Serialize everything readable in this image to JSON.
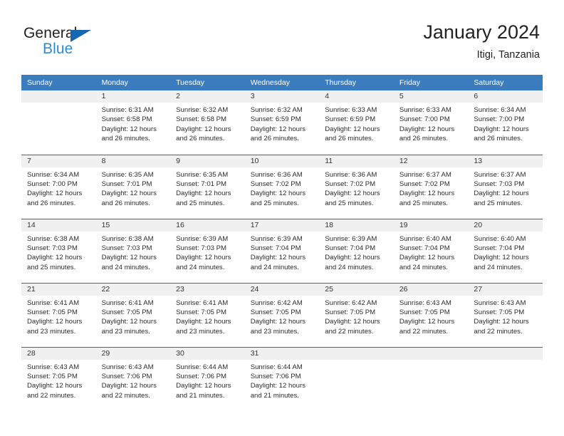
{
  "brand": {
    "name_part1": "General",
    "name_part2": "Blue",
    "triangle_icon": "triangle-icon",
    "colors": {
      "dark": "#231f20",
      "blue": "#2e8bd0",
      "triangle": "#1667b1"
    }
  },
  "header": {
    "title": "January 2024",
    "subtitle": "Itigi, Tanzania"
  },
  "theme": {
    "header_bg": "#3a7cbe",
    "header_text": "#ffffff",
    "daynum_band_bg": "#f0f0f0",
    "row_divider": "#2a6dad",
    "body_text": "#2b2b2b"
  },
  "calendar": {
    "weekday_headers": [
      "Sunday",
      "Monday",
      "Tuesday",
      "Wednesday",
      "Thursday",
      "Friday",
      "Saturday"
    ],
    "weeks": [
      [
        {
          "day": "",
          "lines": []
        },
        {
          "day": "1",
          "lines": [
            "Sunrise: 6:31 AM",
            "Sunset: 6:58 PM",
            "Daylight: 12 hours",
            "and 26 minutes."
          ]
        },
        {
          "day": "2",
          "lines": [
            "Sunrise: 6:32 AM",
            "Sunset: 6:58 PM",
            "Daylight: 12 hours",
            "and 26 minutes."
          ]
        },
        {
          "day": "3",
          "lines": [
            "Sunrise: 6:32 AM",
            "Sunset: 6:59 PM",
            "Daylight: 12 hours",
            "and 26 minutes."
          ]
        },
        {
          "day": "4",
          "lines": [
            "Sunrise: 6:33 AM",
            "Sunset: 6:59 PM",
            "Daylight: 12 hours",
            "and 26 minutes."
          ]
        },
        {
          "day": "5",
          "lines": [
            "Sunrise: 6:33 AM",
            "Sunset: 7:00 PM",
            "Daylight: 12 hours",
            "and 26 minutes."
          ]
        },
        {
          "day": "6",
          "lines": [
            "Sunrise: 6:34 AM",
            "Sunset: 7:00 PM",
            "Daylight: 12 hours",
            "and 26 minutes."
          ]
        }
      ],
      [
        {
          "day": "7",
          "lines": [
            "Sunrise: 6:34 AM",
            "Sunset: 7:00 PM",
            "Daylight: 12 hours",
            "and 26 minutes."
          ]
        },
        {
          "day": "8",
          "lines": [
            "Sunrise: 6:35 AM",
            "Sunset: 7:01 PM",
            "Daylight: 12 hours",
            "and 26 minutes."
          ]
        },
        {
          "day": "9",
          "lines": [
            "Sunrise: 6:35 AM",
            "Sunset: 7:01 PM",
            "Daylight: 12 hours",
            "and 25 minutes."
          ]
        },
        {
          "day": "10",
          "lines": [
            "Sunrise: 6:36 AM",
            "Sunset: 7:02 PM",
            "Daylight: 12 hours",
            "and 25 minutes."
          ]
        },
        {
          "day": "11",
          "lines": [
            "Sunrise: 6:36 AM",
            "Sunset: 7:02 PM",
            "Daylight: 12 hours",
            "and 25 minutes."
          ]
        },
        {
          "day": "12",
          "lines": [
            "Sunrise: 6:37 AM",
            "Sunset: 7:02 PM",
            "Daylight: 12 hours",
            "and 25 minutes."
          ]
        },
        {
          "day": "13",
          "lines": [
            "Sunrise: 6:37 AM",
            "Sunset: 7:03 PM",
            "Daylight: 12 hours",
            "and 25 minutes."
          ]
        }
      ],
      [
        {
          "day": "14",
          "lines": [
            "Sunrise: 6:38 AM",
            "Sunset: 7:03 PM",
            "Daylight: 12 hours",
            "and 25 minutes."
          ]
        },
        {
          "day": "15",
          "lines": [
            "Sunrise: 6:38 AM",
            "Sunset: 7:03 PM",
            "Daylight: 12 hours",
            "and 24 minutes."
          ]
        },
        {
          "day": "16",
          "lines": [
            "Sunrise: 6:39 AM",
            "Sunset: 7:03 PM",
            "Daylight: 12 hours",
            "and 24 minutes."
          ]
        },
        {
          "day": "17",
          "lines": [
            "Sunrise: 6:39 AM",
            "Sunset: 7:04 PM",
            "Daylight: 12 hours",
            "and 24 minutes."
          ]
        },
        {
          "day": "18",
          "lines": [
            "Sunrise: 6:39 AM",
            "Sunset: 7:04 PM",
            "Daylight: 12 hours",
            "and 24 minutes."
          ]
        },
        {
          "day": "19",
          "lines": [
            "Sunrise: 6:40 AM",
            "Sunset: 7:04 PM",
            "Daylight: 12 hours",
            "and 24 minutes."
          ]
        },
        {
          "day": "20",
          "lines": [
            "Sunrise: 6:40 AM",
            "Sunset: 7:04 PM",
            "Daylight: 12 hours",
            "and 24 minutes."
          ]
        }
      ],
      [
        {
          "day": "21",
          "lines": [
            "Sunrise: 6:41 AM",
            "Sunset: 7:05 PM",
            "Daylight: 12 hours",
            "and 23 minutes."
          ]
        },
        {
          "day": "22",
          "lines": [
            "Sunrise: 6:41 AM",
            "Sunset: 7:05 PM",
            "Daylight: 12 hours",
            "and 23 minutes."
          ]
        },
        {
          "day": "23",
          "lines": [
            "Sunrise: 6:41 AM",
            "Sunset: 7:05 PM",
            "Daylight: 12 hours",
            "and 23 minutes."
          ]
        },
        {
          "day": "24",
          "lines": [
            "Sunrise: 6:42 AM",
            "Sunset: 7:05 PM",
            "Daylight: 12 hours",
            "and 23 minutes."
          ]
        },
        {
          "day": "25",
          "lines": [
            "Sunrise: 6:42 AM",
            "Sunset: 7:05 PM",
            "Daylight: 12 hours",
            "and 22 minutes."
          ]
        },
        {
          "day": "26",
          "lines": [
            "Sunrise: 6:43 AM",
            "Sunset: 7:05 PM",
            "Daylight: 12 hours",
            "and 22 minutes."
          ]
        },
        {
          "day": "27",
          "lines": [
            "Sunrise: 6:43 AM",
            "Sunset: 7:05 PM",
            "Daylight: 12 hours",
            "and 22 minutes."
          ]
        }
      ],
      [
        {
          "day": "28",
          "lines": [
            "Sunrise: 6:43 AM",
            "Sunset: 7:05 PM",
            "Daylight: 12 hours",
            "and 22 minutes."
          ]
        },
        {
          "day": "29",
          "lines": [
            "Sunrise: 6:43 AM",
            "Sunset: 7:06 PM",
            "Daylight: 12 hours",
            "and 22 minutes."
          ]
        },
        {
          "day": "30",
          "lines": [
            "Sunrise: 6:44 AM",
            "Sunset: 7:06 PM",
            "Daylight: 12 hours",
            "and 21 minutes."
          ]
        },
        {
          "day": "31",
          "lines": [
            "Sunrise: 6:44 AM",
            "Sunset: 7:06 PM",
            "Daylight: 12 hours",
            "and 21 minutes."
          ]
        },
        {
          "day": "",
          "lines": []
        },
        {
          "day": "",
          "lines": []
        },
        {
          "day": "",
          "lines": []
        }
      ]
    ]
  }
}
